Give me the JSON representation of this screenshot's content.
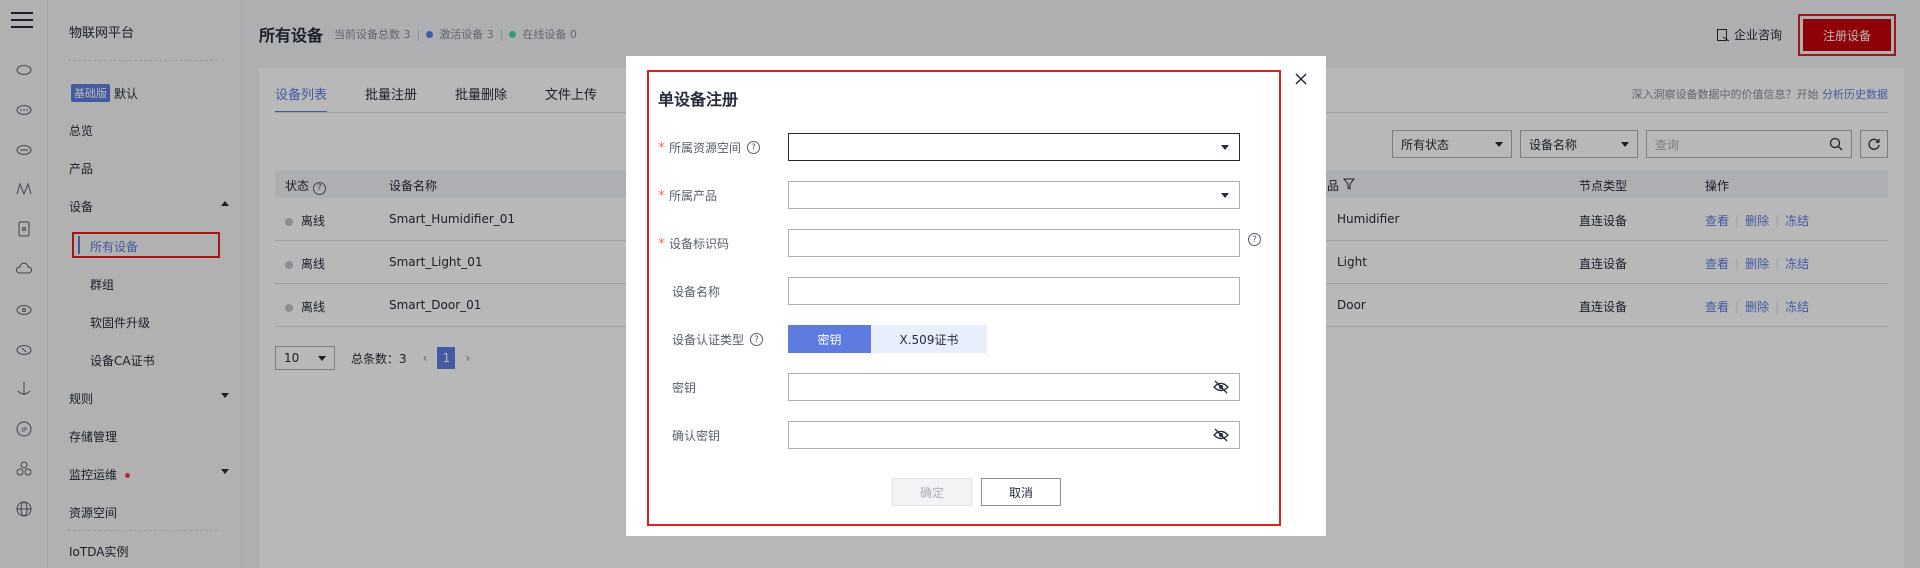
{
  "sidebar": {
    "title": "物联网平台",
    "edition_badge": "基础版",
    "edition_name": "默认",
    "items": [
      "总览",
      "产品",
      "设备",
      "规则",
      "存储管理",
      "监控运维",
      "资源空间",
      "IoTDA实例"
    ],
    "device_sub": [
      "所有设备",
      "群组",
      "软固件升级",
      "设备CA证书"
    ]
  },
  "header": {
    "title": "所有设备",
    "stat_total": "当前设备总数 3",
    "stat_active": "激活设备 3",
    "stat_online": "在线设备 0",
    "consult": "企业咨询",
    "register_button": "注册设备"
  },
  "tabs": [
    "设备列表",
    "批量注册",
    "批量删除",
    "文件上传"
  ],
  "insight": {
    "text": "深入洞察设备数据中的价值信息？开始",
    "link": "分析历史数据"
  },
  "filters": {
    "status": "所有状态",
    "field": "设备名称",
    "search_placeholder": "查询"
  },
  "table": {
    "headers": {
      "status": "状态",
      "name": "设备名称",
      "product_suffix": "品",
      "node_type": "节点类型",
      "ops": "操作"
    },
    "rows": [
      {
        "status": "离线",
        "name": "Smart_Humidifier_01",
        "product": "Humidifier",
        "node_type": "直连设备"
      },
      {
        "status": "离线",
        "name": "Smart_Light_01",
        "product": "Light",
        "node_type": "直连设备"
      },
      {
        "status": "离线",
        "name": "Smart_Door_01",
        "product": "Door",
        "node_type": "直连设备"
      }
    ],
    "ops": {
      "view": "查看",
      "delete": "删除",
      "freeze": "冻结"
    }
  },
  "pager": {
    "size": "10",
    "total": "总条数：3",
    "page": "1"
  },
  "modal": {
    "title": "单设备注册",
    "labels": {
      "space": "所属资源空间",
      "product": "所属产品",
      "node_id": "设备标识码",
      "device_name": "设备名称",
      "auth_type": "设备认证类型",
      "secret": "密钥",
      "confirm_secret": "确认密钥"
    },
    "required_mark": "*",
    "auth_options": [
      "密钥",
      "X.509证书"
    ],
    "ok": "确定",
    "cancel": "取消"
  },
  "colors": {
    "brand_red": "#c7000b",
    "accent": "#5e7ce0",
    "highlight": "#e02020"
  }
}
